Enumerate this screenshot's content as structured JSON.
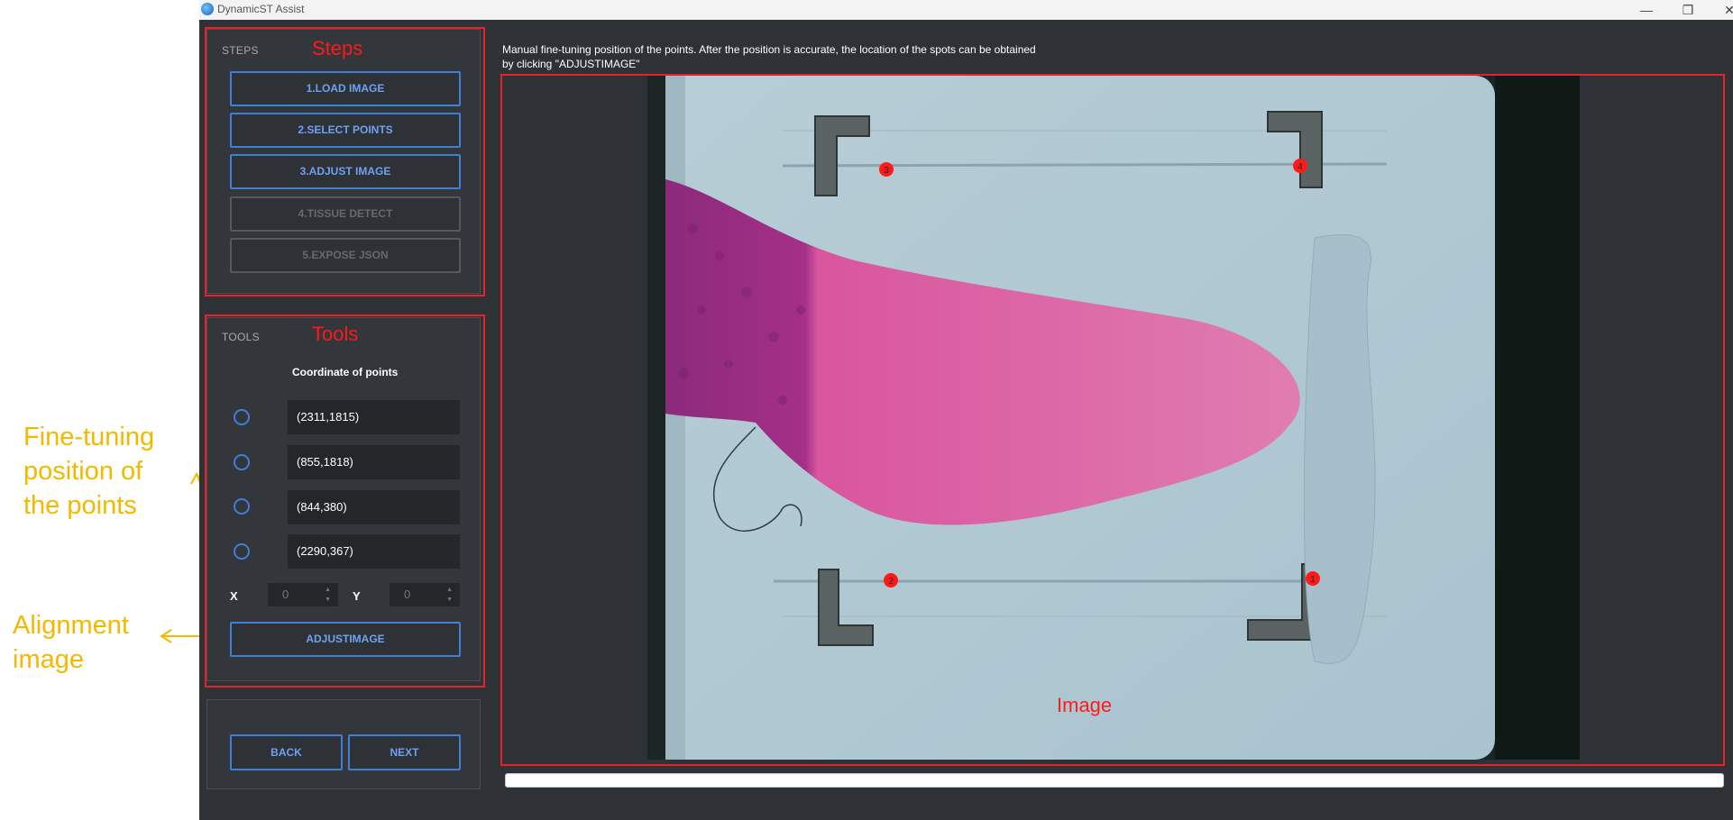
{
  "window": {
    "title": "DynamicST Assist",
    "minimize": "—",
    "restore": "❐",
    "close": "✕"
  },
  "annotations": {
    "fine_tuning": "Fine-tuning\nposition of\nthe points",
    "alignment": "Alignment\nimage",
    "steps": "Steps",
    "tools": "Tools",
    "image": "Image",
    "color": "#f5b800",
    "frame_color": "#e8202a"
  },
  "steps": {
    "title": "STEPS",
    "buttons": [
      {
        "label": "1.LOAD IMAGE",
        "enabled": true
      },
      {
        "label": "2.SELECT POINTS",
        "enabled": true
      },
      {
        "label": "3.ADJUST IMAGE",
        "enabled": true
      },
      {
        "label": "4.TISSUE DETECT",
        "enabled": false
      },
      {
        "label": "5.EXPOSE JSON",
        "enabled": false
      }
    ]
  },
  "tools": {
    "title": "TOOLS",
    "coord_heading": "Coordinate of points",
    "coords": [
      "(2311,1815)",
      "(855,1818)",
      "(844,380)",
      "(2290,367)"
    ],
    "x_label": "X",
    "y_label": "Y",
    "x_value": "0",
    "y_value": "0",
    "adjust_button": "ADJUSTIMAGE"
  },
  "nav": {
    "back": "BACK",
    "next": "NEXT"
  },
  "instruction": {
    "line1": "Manual fine-tuning position of the points. After the position is accurate, the location of the spots can be obtained",
    "line2": "by clicking \"ADJUSTIMAGE\""
  },
  "markers": [
    "1",
    "2",
    "3",
    "4"
  ],
  "accent": "#3f7fd6"
}
